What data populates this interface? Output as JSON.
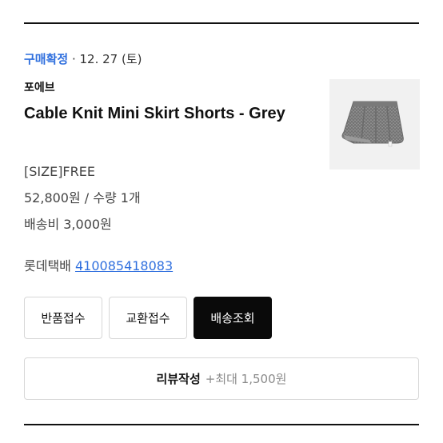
{
  "order": {
    "status_label": "구매확정",
    "status_separator": " · ",
    "status_date": "12. 27 (토)",
    "brand": "포에브",
    "product_name": "Cable Knit Mini Skirt Shorts - Grey",
    "option": "[SIZE]FREE",
    "price_qty": "52,800원 / 수량 1개",
    "shipping_fee": "배송비 3,000원",
    "courier": "롯데택배",
    "tracking_number": "410085418083",
    "thumbnail_icon": "skirt-shorts-product-image"
  },
  "actions": {
    "return_label": "반품접수",
    "exchange_label": "교환접수",
    "tracking_label": "배송조회"
  },
  "review": {
    "label": "리뷰작성",
    "reward": "+최대 1,500원"
  },
  "colors": {
    "accent": "#2f6fde",
    "primary_button": "#0a0a0a"
  }
}
